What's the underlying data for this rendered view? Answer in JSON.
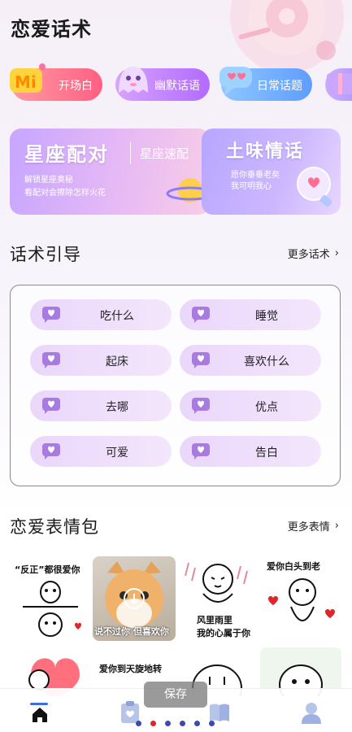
{
  "header": {
    "title": "恋爱话术"
  },
  "chips": [
    {
      "label": "开场白",
      "icon": "mi-badge-icon"
    },
    {
      "label": "幽默话语",
      "icon": "ghost-icon"
    },
    {
      "label": "日常话题",
      "icon": "chat-bubble-icon"
    },
    {
      "label": "",
      "icon": "gift-icon"
    }
  ],
  "banners": {
    "left": {
      "title": "星座配对",
      "subtitle": "星座速配",
      "desc1": "解锁星座奥秘",
      "desc2": "看配对会擦除怎样火花"
    },
    "right": {
      "title": "土味情话",
      "desc1": "愿你垂垂老矣",
      "desc2": "我可明我心"
    }
  },
  "guide_section": {
    "title": "话术引导",
    "more_label": "更多话术",
    "items": [
      "吃什么",
      "睡觉",
      "起床",
      "喜欢什么",
      "去哪",
      "优点",
      "可爱",
      "告白"
    ]
  },
  "sticker_section": {
    "title": "恋爱表情包",
    "more_label": "更多表情",
    "stickers": [
      {
        "caption": "“反正”都很爱你"
      },
      {
        "caption": "说不过你 但喜欢你"
      },
      {
        "caption1": "风里雨里",
        "caption2": "我的心属于你"
      },
      {
        "caption": "爱你白头到老"
      },
      {
        "caption": ""
      },
      {
        "caption": "爱你到天旋地转"
      },
      {
        "caption": ""
      }
    ]
  },
  "toast": {
    "label": "保存"
  },
  "tabs": [
    {
      "icon": "home-icon",
      "active": true
    },
    {
      "icon": "clipboard-heart-icon",
      "active": false
    },
    {
      "icon": "book-icon",
      "active": false
    },
    {
      "icon": "profile-icon",
      "active": false
    }
  ],
  "pager": {
    "count": 6,
    "active_index": 1
  },
  "colors": {
    "accent": "#3b6fe0",
    "pill": "#ead7fb",
    "heart": "#a77be0"
  }
}
